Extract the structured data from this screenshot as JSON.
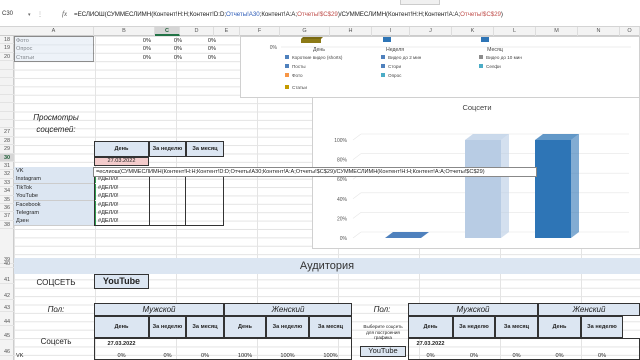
{
  "name_box": "C30",
  "formula_bar": {
    "fx": "fx",
    "prefix": "=",
    "text_parts": [
      {
        "t": "ЕСЛИОШ(СУММЕСЛИМН(Контент!Н:Н;Контент!D:D;",
        "c": ""
      },
      {
        "t": "Отчеты!A30",
        "c": "b"
      },
      {
        "t": ";Контент!A:A;",
        "c": ""
      },
      {
        "t": "Отчеты!$C$29",
        "c": "r"
      },
      {
        "t": ")/СУММЕСЛИМН(Контент!Н:Н;Контент!A:A;",
        "c": ""
      },
      {
        "t": "Отчеты!$C$29",
        "c": "r"
      },
      {
        "t": ")",
        "c": ""
      }
    ]
  },
  "columns": [
    "A",
    "B",
    "C",
    "D",
    "E",
    "F",
    "G",
    "H",
    "I",
    "J",
    "K",
    "L",
    "M",
    "N",
    "O"
  ],
  "rows": [
    "18",
    "19",
    "20",
    "",
    "",
    "",
    "",
    "",
    "",
    "",
    "",
    "27",
    "28",
    "29",
    "30",
    "31",
    "32",
    "33",
    "34",
    "35",
    "36",
    "37",
    "38",
    "39",
    "40",
    "41",
    "42",
    "43",
    "44",
    "45",
    "46"
  ],
  "top_rows": [
    {
      "label": "Фото",
      "c": "0%",
      "d": "0%",
      "e": "0%"
    },
    {
      "label": "Опрос",
      "c": "0%",
      "d": "0%",
      "e": "0%"
    },
    {
      "label": "Статьи",
      "c": "0%",
      "d": "0%",
      "e": "0%"
    }
  ],
  "chart1": {
    "y_tick": "0%",
    "categories": [
      "День",
      "Неделя",
      "Месяц"
    ],
    "legend": [
      "Короткие видео (shorts)",
      "Видео до 2 мин",
      "Видео до 10 мин",
      "Видео до 10 мин",
      "Посты",
      "Стори",
      "Селфи",
      "Фото",
      "Опрос",
      "Статьи"
    ],
    "legend_colors": [
      "#4f81bd",
      "#4f81bd",
      "#8c8c8c",
      "#8c8c8c",
      "#4f81bd",
      "#4f81bd",
      "#4bacc6",
      "#f79646",
      "#4bacc6",
      "#c49a00"
    ]
  },
  "views_title": "Просмотры соцсетей:",
  "views_header": {
    "day": "День",
    "week": "За неделю",
    "month": "За месяц"
  },
  "date": "27.03.2022",
  "social_rows": [
    {
      "name": "VK",
      "value": ""
    },
    {
      "name": "Instagram",
      "value": "#ДЕЛ/0!"
    },
    {
      "name": "TikTok",
      "value": "#ДЕЛ/0!"
    },
    {
      "name": "YouTube",
      "value": "#ДЕЛ/0!"
    },
    {
      "name": "Facebook",
      "value": "#ДЕЛ/0!"
    },
    {
      "name": "Telegram",
      "value": "#ДЕЛ/0!"
    },
    {
      "name": "Дзен",
      "value": "#ДЕЛ/0!"
    }
  ],
  "formula_overlay": "=еслиош(СУММЕСЛИМН(Контент!Н:Н;Контент!D:D;Отчеты!A30;Контент!A:A;Отчеты!$C$29)/СУММЕСЛИМН(Контент!Н:Н;Контент!A:A;Отчеты!$C$29)",
  "chart2": {
    "title": "Соцсети",
    "y_ticks": [
      "100%",
      "80%",
      "60%",
      "40%",
      "20%",
      "0%"
    ],
    "chart_data": {
      "type": "bar",
      "categories": [
        "",
        "",
        ""
      ],
      "values": [
        0,
        100,
        100
      ],
      "ylim": [
        0,
        100
      ],
      "colors": [
        "#4f81bd",
        "#b8cce4",
        "#2e75b6"
      ]
    }
  },
  "audience": {
    "title": "Аудитория",
    "social_label": "СОЦСЕТЬ",
    "social_value": "YouTube",
    "gender_label": "Пол:",
    "male": "Мужской",
    "female": "Женский",
    "day": "День",
    "week": "За неделю",
    "month": "За месяц",
    "social_col": "Соцсеть",
    "date": "27.03.2022",
    "vk": "VK",
    "row_vals": [
      "0%",
      "0%",
      "0%",
      "100%",
      "100%",
      "100%"
    ],
    "right_row_vals": [
      "0%",
      "0%",
      "0%",
      "0%",
      "0%"
    ],
    "hint": "Выберите соцсеть для построения графика",
    "right_social": "YouTube"
  }
}
